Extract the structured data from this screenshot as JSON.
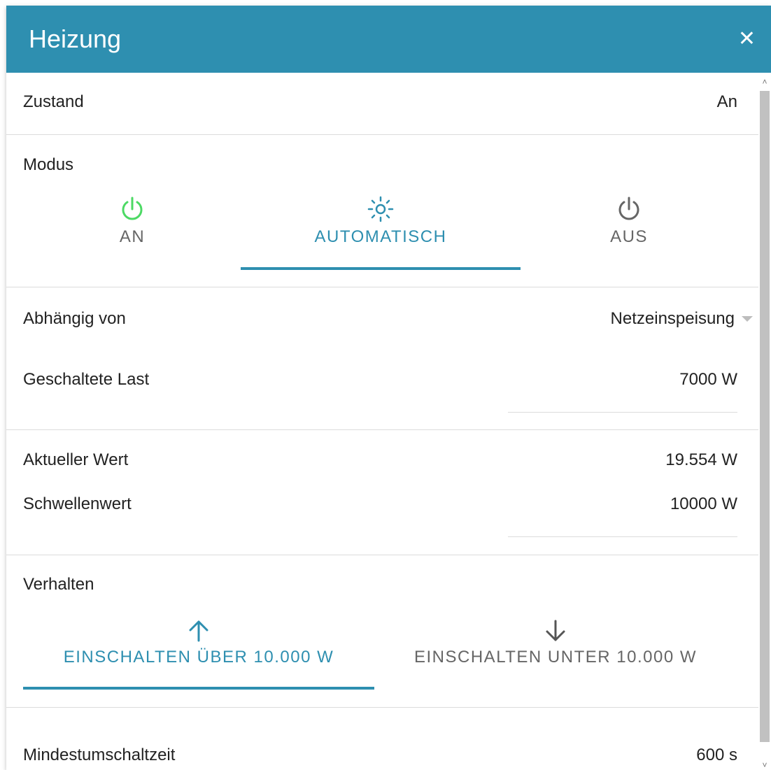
{
  "colors": {
    "header": "#2e8fb0",
    "accent": "#2e8fb0",
    "on_icon": "#4cd964",
    "inactive": "#666666"
  },
  "header": {
    "title": "Heizung",
    "close_icon": "close-icon",
    "close_glyph": "✕"
  },
  "state": {
    "label": "Zustand",
    "value": "An"
  },
  "mode": {
    "label": "Modus",
    "tabs": [
      {
        "label": "AN",
        "icon": "power-icon",
        "active": false
      },
      {
        "label": "AUTOMATISCH",
        "icon": "sun-icon",
        "active": true
      },
      {
        "label": "AUS",
        "icon": "power-icon",
        "active": false
      }
    ]
  },
  "dependency": {
    "label": "Abhängig von",
    "value": "Netzeinspeisung"
  },
  "switched_load": {
    "label": "Geschaltete Last",
    "value": "7000 W"
  },
  "current_value": {
    "label": "Aktueller Wert",
    "value": "19.554 W"
  },
  "threshold": {
    "label": "Schwellenwert",
    "value": "10000 W"
  },
  "behavior": {
    "label": "Verhalten",
    "tabs": [
      {
        "label": "EINSCHALTEN ÜBER 10.000 W",
        "icon": "arrow-up-icon",
        "active": true
      },
      {
        "label": "EINSCHALTEN UNTER 10.000 W",
        "icon": "arrow-down-icon",
        "active": false
      }
    ]
  },
  "min_switch_time": {
    "label": "Mindestumschaltzeit",
    "value": "600 s"
  }
}
